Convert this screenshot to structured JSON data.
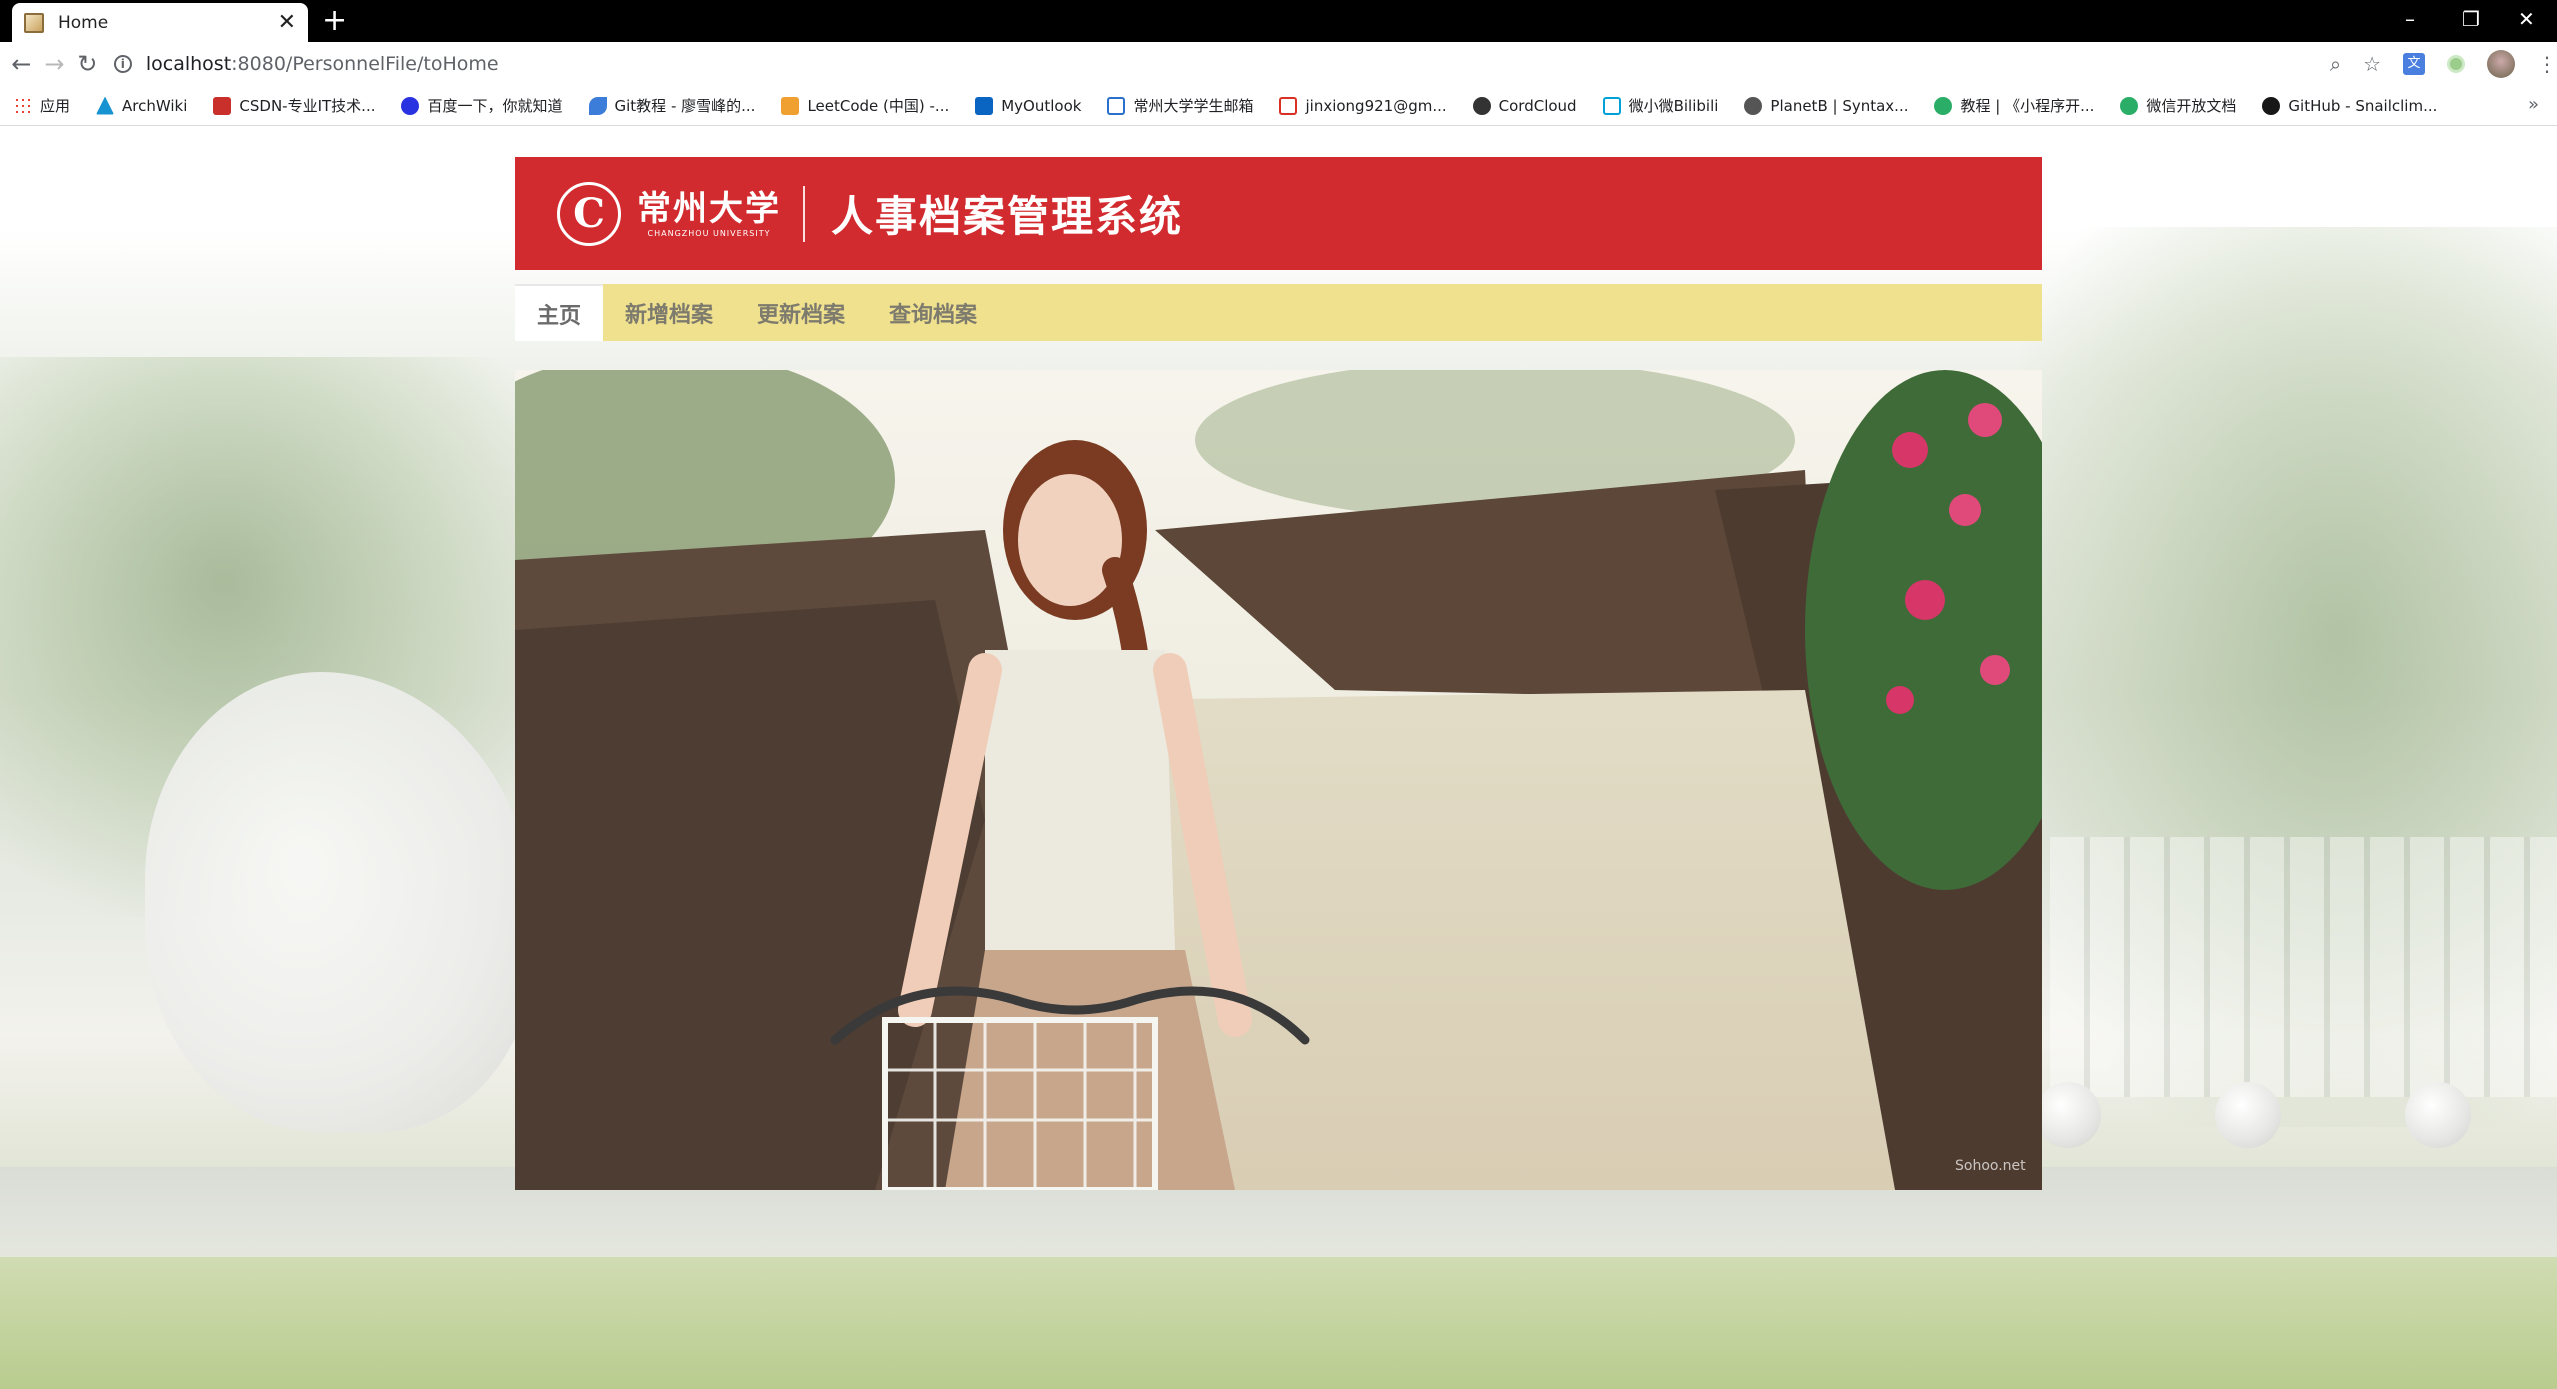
{
  "browser": {
    "tab_title": "Home",
    "tab_close": "✕",
    "new_tab": "+",
    "url_host": "localhost",
    "url_path": ":8080/PersonnelFile/toHome",
    "win_minimize": "–",
    "win_restore": "❐",
    "win_close": "✕"
  },
  "bookmarks": {
    "items": [
      {
        "label": "应用",
        "icon_color": "#4285f4"
      },
      {
        "label": "ArchWiki",
        "icon_color": "#1793d1"
      },
      {
        "label": "CSDN-专业IT技术...",
        "icon_color": "#c9302c"
      },
      {
        "label": "百度一下，你就知道",
        "icon_color": "#2932e1"
      },
      {
        "label": "Git教程 - 廖雪峰的...",
        "icon_color": "#3b7dd8"
      },
      {
        "label": "LeetCode (中国) -...",
        "icon_color": "#f0a030"
      },
      {
        "label": "MyOutlook",
        "icon_color": "#0a64c2"
      },
      {
        "label": "常州大学学生邮箱",
        "icon_color": "#2a6fc9"
      },
      {
        "label": "jinxiong921@gm...",
        "icon_color": "#d93025"
      },
      {
        "label": "CordCloud",
        "icon_color": "#333333"
      },
      {
        "label": "微小微Bilibili",
        "icon_color": "#00a1d6"
      },
      {
        "label": "PlanetB | Syntax...",
        "icon_color": "#555555"
      },
      {
        "label": "教程 | 《小程序开...",
        "icon_color": "#2aae67"
      },
      {
        "label": "微信开放文档",
        "icon_color": "#2aae67"
      },
      {
        "label": "GitHub - Snailclim...",
        "icon_color": "#181717"
      }
    ],
    "more": "»"
  },
  "header": {
    "logo_mark": "C",
    "logo_cn": "常州大学",
    "logo_en": "CHANGZHOU UNIVERSITY",
    "system_title": "人事档案管理系统",
    "bg_color": "#d22b2f"
  },
  "nav": {
    "items": [
      {
        "label": "主页",
        "active": true
      },
      {
        "label": "新增档案",
        "active": false
      },
      {
        "label": "更新档案",
        "active": false
      },
      {
        "label": "查询档案",
        "active": false
      }
    ],
    "bg_color": "#efe18d"
  },
  "hero": {
    "watermark": "Sohoo.net"
  }
}
